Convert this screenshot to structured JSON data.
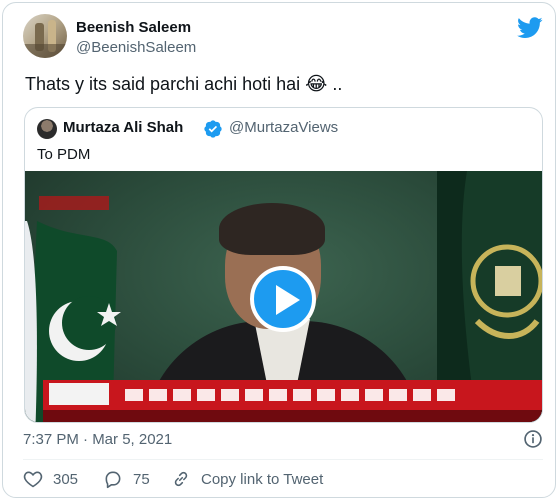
{
  "tweet": {
    "author": {
      "name": "Beenish Saleem",
      "handle": "@BeenishSaleem"
    },
    "text": "Thats y its said parchi achi hoti hai",
    "text_emoji": "😂",
    "text_suffix": " ..",
    "timestamp": "7:37 PM · Mar 5, 2021",
    "actions": {
      "likes": "305",
      "replies": "75",
      "copy_link_label": "Copy link to Tweet"
    }
  },
  "quoted_tweet": {
    "author": {
      "name": "Murtaza Ali Shah",
      "handle": "@MurtazaViews",
      "verified": true
    },
    "text": "To PDM",
    "media": {
      "type": "video",
      "play_icon": "play-icon"
    }
  },
  "icons": {
    "brand": "twitter-bird-icon",
    "info": "info-icon",
    "like": "heart-icon",
    "reply": "comment-icon",
    "copy_link": "link-icon",
    "verified": "verified-badge-icon"
  },
  "colors": {
    "brand_blue": "#1d9bf0",
    "text_primary": "#0f1419",
    "text_secondary": "#536471",
    "border": "#cfd9de"
  }
}
